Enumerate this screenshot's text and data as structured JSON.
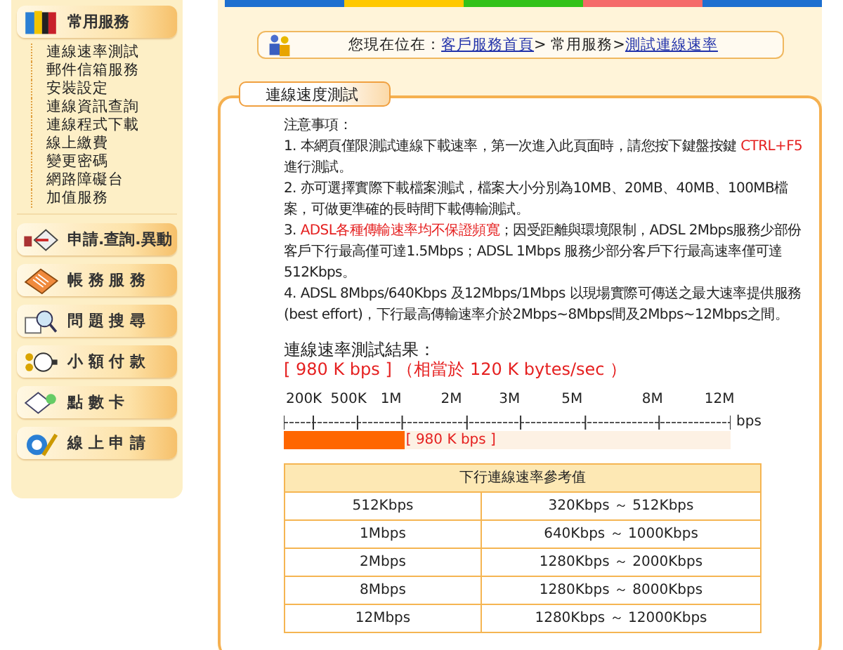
{
  "top_stripe": [
    {
      "color": "#1d6fd0"
    },
    {
      "color": "#ffc800"
    },
    {
      "color": "#33c21a"
    },
    {
      "color": "#f56a6a"
    },
    {
      "color": "#1d6fd0"
    }
  ],
  "sidebar": {
    "header": "常用服務",
    "items": [
      "連線速率測試",
      "郵件信箱服務",
      "安裝設定",
      "連線資訊查詢",
      "連線程式下載",
      "線上繳費",
      "變更密碼",
      "網路障礙台",
      "加值服務"
    ],
    "buttons": [
      {
        "kind": "apply",
        "label": "申請.查詢.異動"
      },
      {
        "kind": "billing",
        "label": "帳 務 服 務"
      },
      {
        "kind": "faq",
        "label": "問 題 搜 尋"
      },
      {
        "kind": "payment",
        "label": "小 額 付 款"
      },
      {
        "kind": "card",
        "label": "點 數 卡"
      },
      {
        "kind": "online",
        "label": "線 上 申 請"
      }
    ]
  },
  "breadcrumb": {
    "prefix": "您現在位在：",
    "links": [
      {
        "text": "客戶服務首頁",
        "link": true
      },
      {
        "text": "> 常用服務>",
        "link": false
      },
      {
        "text": "測試連線速率",
        "link": true
      }
    ]
  },
  "panel": {
    "title": "連線速度測試",
    "notes_heading": "注意事項：",
    "notes": [
      [
        {
          "text": "1. 本網頁僅限測試連線下載速率，第一次進入此頁面時，請您按下鍵盤按鍵 ",
          "highlight": false
        },
        {
          "text": "CTRL+F5",
          "highlight": true
        },
        {
          "text": " 進行測試。",
          "highlight": false
        }
      ],
      [
        {
          "text": "2. 亦可選擇實際下載檔案測試，檔案大小分別為10MB、20MB、40MB、100MB檔案，可做更準確的長時間下載傳輸測試。",
          "highlight": false
        }
      ],
      [
        {
          "text": "3. ",
          "highlight": false
        },
        {
          "text": "ADSL各種傳輸速率均不保證頻寬",
          "highlight": true
        },
        {
          "text": "；因受距離與環境限制，ADSL 2Mbps服務少部份客戶下行最高僅可達1.5Mbps；ADSL 1Mbps 服務少部分客戶下行最高速率僅可達512Kbps。",
          "highlight": false
        }
      ],
      [
        {
          "text": "4. ADSL 8Mbps/640Kbps 及12Mbps/1Mbps 以現場實際可傳送之最大速率提供服務(best effort)，下行最高傳輸速率介於2Mbps~8Mbps間及2Mbps~12Mbps之間。",
          "highlight": false
        }
      ]
    ],
    "result_label": "連線速率測試結果：",
    "result_value": "[ 980 K bps ] （相當於 120 K bytes/sec ）",
    "scale": {
      "ticks": [
        "200K",
        "500K",
        "1M",
        "2M",
        "3M",
        "5M",
        "8M",
        "12M"
      ],
      "unit": "bps",
      "level": 0.27,
      "reading": "[ 980 K bps ]"
    },
    "table": {
      "title": "下行連線速率參考值",
      "rows": [
        [
          "512Kbps",
          "320Kbps ～ 512Kbps"
        ],
        [
          "1Mbps",
          "640Kbps ～ 1000Kbps"
        ],
        [
          "2Mbps",
          "1280Kbps ～ 2000Kbps"
        ],
        [
          "8Mbps",
          "1280Kbps ～ 8000Kbps"
        ],
        [
          "12Mbps",
          "1280Kbps ～ 12000Kbps"
        ]
      ]
    }
  }
}
